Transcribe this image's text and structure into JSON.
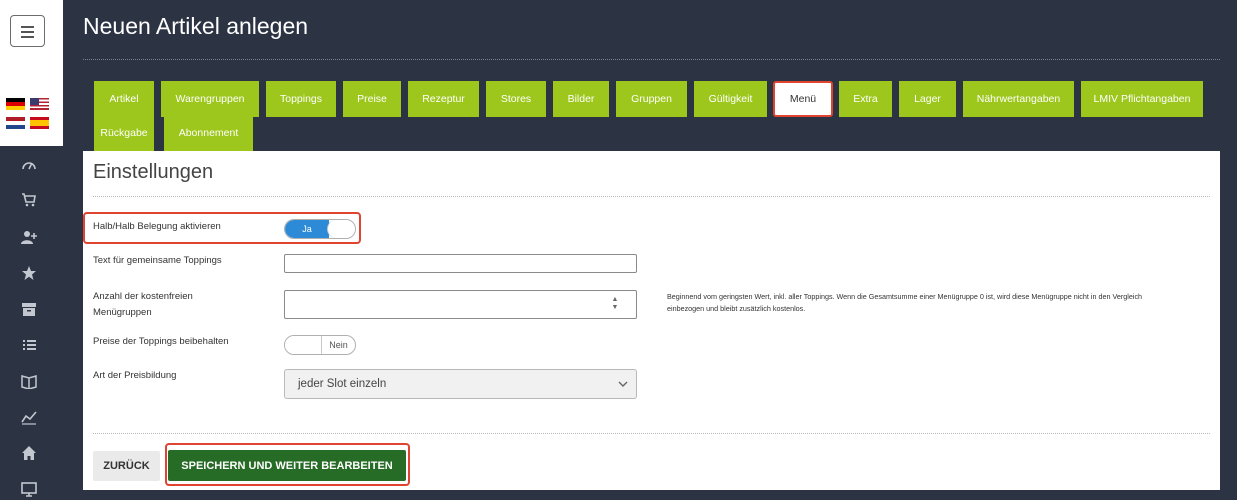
{
  "header": {
    "title": "Neuen Artikel anlegen"
  },
  "sidebar": {
    "icons": [
      "dashboard-icon",
      "cart-icon",
      "add-user-icon",
      "star-icon",
      "archive-icon",
      "list-icon",
      "book-icon",
      "chart-icon",
      "home-icon",
      "monitor-icon"
    ],
    "languages": [
      "de",
      "en-us",
      "nl",
      "es"
    ]
  },
  "tabs": [
    {
      "label": "Artikel"
    },
    {
      "label": "Warengruppen"
    },
    {
      "label": "Toppings"
    },
    {
      "label": "Preise"
    },
    {
      "label": "Rezeptur"
    },
    {
      "label": "Stores"
    },
    {
      "label": "Bilder"
    },
    {
      "label": "Gruppen"
    },
    {
      "label": "Gültigkeit"
    },
    {
      "label": "Menü",
      "active": true
    },
    {
      "label": "Extra"
    },
    {
      "label": "Lager"
    },
    {
      "label": "Nährwertangaben"
    },
    {
      "label": "LMIV Pflichtangaben"
    },
    {
      "label": "Rückgabe"
    },
    {
      "label": "Abonnement"
    }
  ],
  "panel": {
    "title": "Einstellungen",
    "fields": {
      "halb_label": "Halb/Halb Belegung aktivieren",
      "halb_toggle": "Ja",
      "text_label": "Text für gemeinsame Toppings",
      "text_value": "",
      "anzahl_label_1": "Anzahl der kostenfreien",
      "anzahl_label_2": "Menügruppen",
      "anzahl_value": "",
      "anzahl_hint_1": "Beginnend vom geringsten Wert, inkl. aller Toppings. Wenn die Gesamtsumme einer Menügruppe 0 ist, wird diese Menügruppe nicht in den Vergleich",
      "anzahl_hint_2": "einbezogen und bleibt zusätzlich kostenlos.",
      "preise_label": "Preise der Toppings beibehalten",
      "preise_toggle": "Nein",
      "art_label": "Art der Preisbildung",
      "art_value": "jeder Slot einzeln"
    },
    "buttons": {
      "back": "ZURÜCK",
      "save": "SPEICHERN UND WEITER BEARBEITEN"
    }
  },
  "colors": {
    "tab_green": "#9dc71c",
    "save_green": "#266b26",
    "highlight_red": "#e0432f",
    "toggle_blue": "#2d8ad6",
    "sidebar_bg": "#2c3444"
  }
}
